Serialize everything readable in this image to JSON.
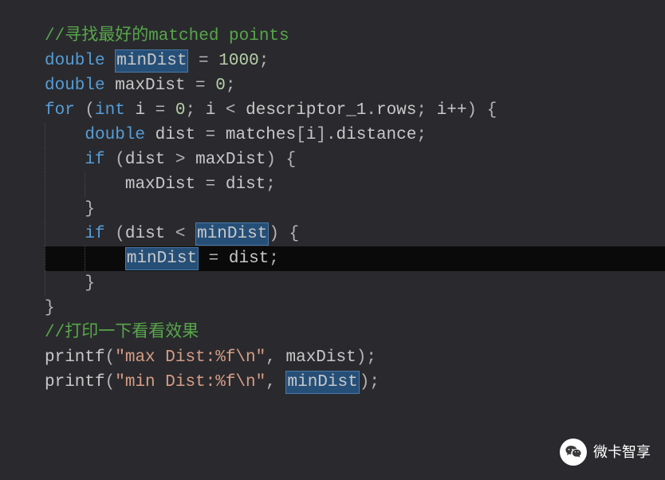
{
  "code": {
    "c1": "//寻找最好的matched points",
    "kw_double": "double",
    "minDist": "minDist",
    "maxDist": "maxDist",
    "eq": " = ",
    "n1000": "1000",
    "n0": "0",
    "semi": ";",
    "kw_for": "for",
    "kw_int": "int",
    "var_i": "i",
    "lt": " < ",
    "gt": " > ",
    "desc": "descriptor_1",
    "dot": ".",
    "rows": "rows",
    "ipp": "i++",
    "obrace": "{",
    "cbrace": "}",
    "dist": "dist",
    "matches": "matches",
    "obrk": "[",
    "cbrk": "]",
    "distance": "distance",
    "kw_if": "if",
    "oparen": "(",
    "cparen": ")",
    "c2": "//打印一下看看效果",
    "printf": "printf",
    "str_max": "\"max Dist:%f\\n\"",
    "str_min": "\"min Dist:%f\\n\"",
    "comma": ", "
  },
  "watermark": {
    "text": "微卡智享"
  }
}
